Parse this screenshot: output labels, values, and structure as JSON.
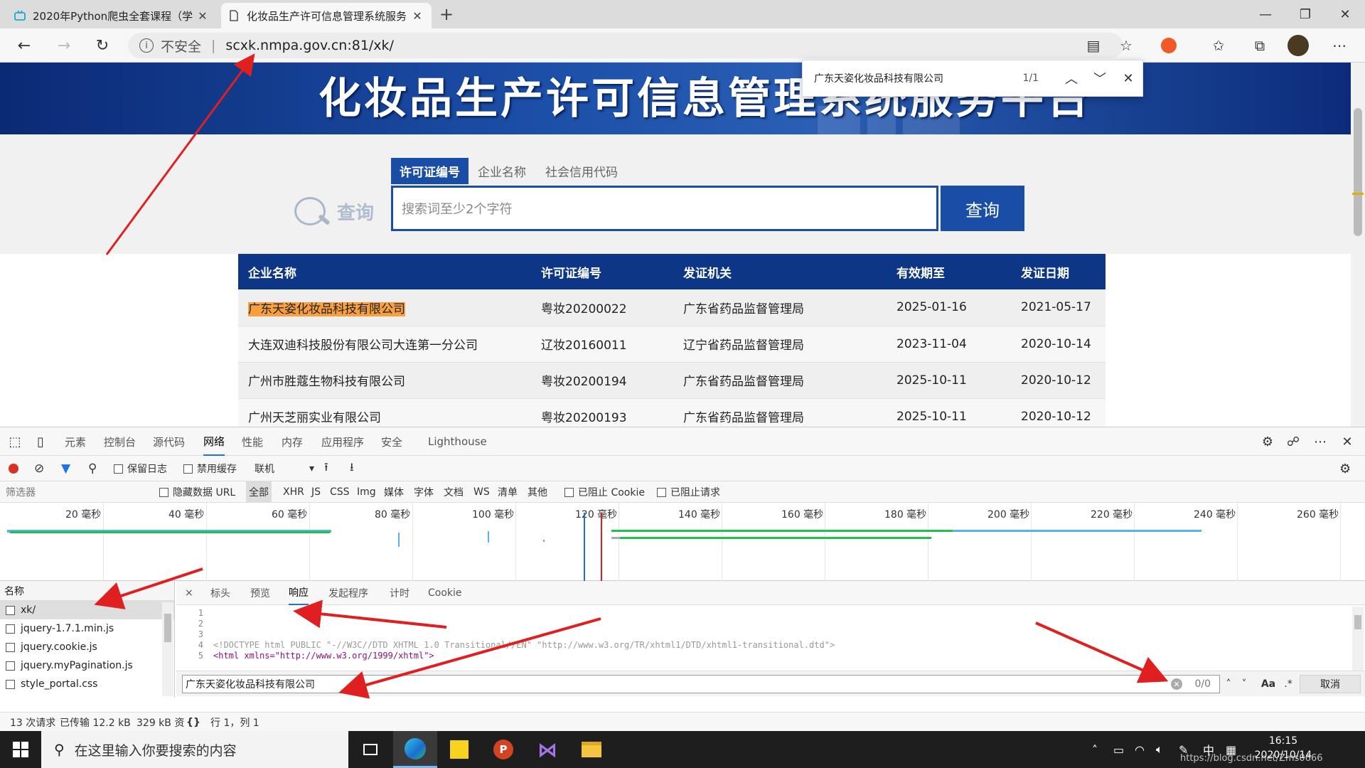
{
  "browser": {
    "tabs": [
      {
        "title": "2020年Python爬虫全套课程（学",
        "active": false
      },
      {
        "title": "化妆品生产许可信息管理系统服务",
        "active": true
      }
    ],
    "address": {
      "security": "不安全",
      "url": "scxk.nmpa.gov.cn:81/xk/"
    },
    "find": {
      "query": "广东天姿化妆品科技有限公司",
      "count": "1/1"
    }
  },
  "page": {
    "banner_title": "化妆品生产许可信息管理系统服务平台",
    "search_tabs": [
      "许可证编号",
      "企业名称",
      "社会信用代码"
    ],
    "logo_text": "查询",
    "search_placeholder": "搜索词至少2个字符",
    "search_button": "查询",
    "table": {
      "headers": [
        "企业名称",
        "许可证编号",
        "发证机关",
        "有效期至",
        "发证日期"
      ],
      "rows": [
        [
          "广东天姿化妆品科技有限公司",
          "粤妆20200022",
          "广东省药品监督管理局",
          "2025-01-16",
          "2021-05-17"
        ],
        [
          "大连双迪科技股份有限公司大连第一分公司",
          "辽妆20160011",
          "辽宁省药品监督管理局",
          "2023-11-04",
          "2020-10-14"
        ],
        [
          "广州市胜蔻生物科技有限公司",
          "粤妆20200194",
          "广东省药品监督管理局",
          "2025-10-11",
          "2020-10-12"
        ],
        [
          "广州天芝丽实业有限公司",
          "粤妆20200193",
          "广东省药品监督管理局",
          "2025-10-11",
          "2020-10-12"
        ]
      ]
    }
  },
  "devtools": {
    "tabs": [
      "元素",
      "控制台",
      "源代码",
      "网络",
      "性能",
      "内存",
      "应用程序",
      "安全",
      "Lighthouse"
    ],
    "active_tab": "网络",
    "toolbar": {
      "preserve_log": "保留日志",
      "disable_cache": "禁用缓存",
      "throttle": "联机"
    },
    "filter": {
      "placeholder": "筛选器",
      "hide_data_url": "隐藏数据 URL",
      "types": [
        "全部",
        "XHR",
        "JS",
        "CSS",
        "Img",
        "媒体",
        "字体",
        "文档",
        "WS",
        "清单",
        "其他"
      ],
      "blocked_cookies": "已阻止 Cookie",
      "blocked_requests": "已阻止请求"
    },
    "timeline_ticks": [
      "20 毫秒",
      "40 毫秒",
      "60 毫秒",
      "80 毫秒",
      "100 毫秒",
      "120 毫秒",
      "140 毫秒",
      "160 毫秒",
      "180 毫秒",
      "200 毫秒",
      "220 毫秒",
      "240 毫秒",
      "260 毫秒"
    ],
    "names_header": "名称",
    "requests": [
      "xk/",
      "jquery-1.7.1.min.js",
      "jquery.cookie.js",
      "jquery.myPagination.js",
      "style_portal.css"
    ],
    "detail_close": "×",
    "detail_tabs": [
      "标头",
      "预览",
      "响应",
      "发起程序",
      "计时",
      "Cookie"
    ],
    "detail_active": "响应",
    "code_lines": [
      {
        "n": "1",
        "text": ""
      },
      {
        "n": "2",
        "text": ""
      },
      {
        "n": "3",
        "text": ""
      },
      {
        "n": "4",
        "text": "<!DOCTYPE html PUBLIC \"-//W3C//DTD XHTML 1.0 Transitional//EN\" \"http://www.w3.org/TR/xhtml1/DTD/xhtml1-transitional.dtd\">"
      },
      {
        "n": "5",
        "text": "<html xmlns=\"http://www.w3.org/1999/xhtml\">"
      }
    ],
    "search": {
      "query": "广东天姿化妆品科技有限公司",
      "count": "0/0",
      "case_label": "Aa",
      "regex_label": ".*",
      "cancel": "取消"
    },
    "status": {
      "requests": "13 次请求",
      "transferred": "已传输 12.2 kB",
      "resources": "329 kB 资",
      "braces": "{}",
      "position": "行 1，列 1"
    }
  },
  "taskbar": {
    "search_placeholder": "在这里输入你要搜索的内容",
    "ime": "中",
    "time": "16:15",
    "date": "2020/10/14",
    "watermark": "https://blog.csdn.net/Zms0666"
  },
  "colors": {
    "brand_blue": "#1a4ea6",
    "table_header": "#0d3687",
    "highlight": "#f8a040",
    "annotation_red": "#e02020"
  }
}
